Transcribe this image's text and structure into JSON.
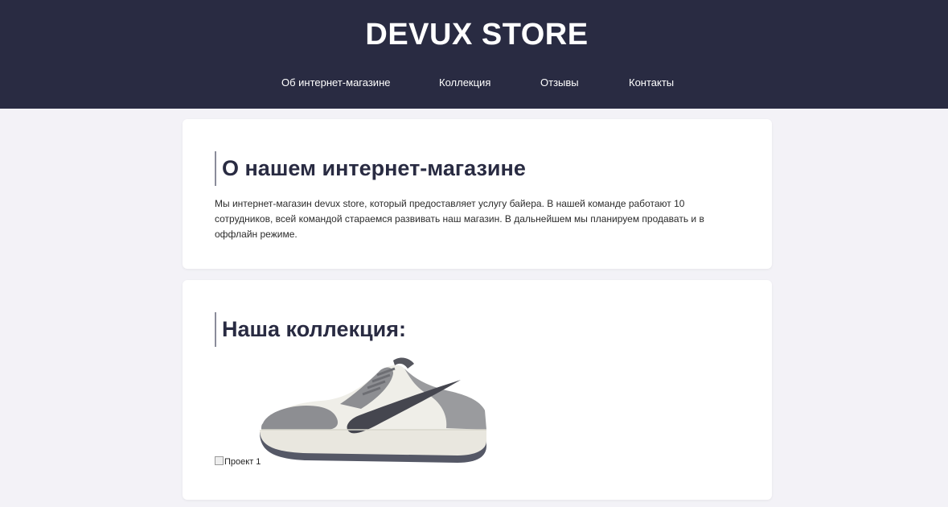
{
  "header": {
    "brand": "DEVUX STORE",
    "nav": [
      {
        "label": "Об интернет-магазине"
      },
      {
        "label": "Коллекция"
      },
      {
        "label": "Отзывы"
      },
      {
        "label": "Контакты"
      }
    ],
    "background_color": "#292b42"
  },
  "about": {
    "title": "О нашем интернет-магазине",
    "text": "Мы интернет-магазин devux store, который предоставляет услугу байера. В нашей команде работают 10 сотрудников, всей командой стараемся развивать наш магазин. В дальнейшем мы планируем продавать и в оффлайн режиме."
  },
  "collection": {
    "title": "Наша коллекция:",
    "items": [
      {
        "alt": "Проект 1",
        "icon": "sneaker-image"
      }
    ]
  },
  "colors": {
    "page_background": "#f3f2f7",
    "card_background": "#ffffff",
    "title_color": "#292b42"
  }
}
